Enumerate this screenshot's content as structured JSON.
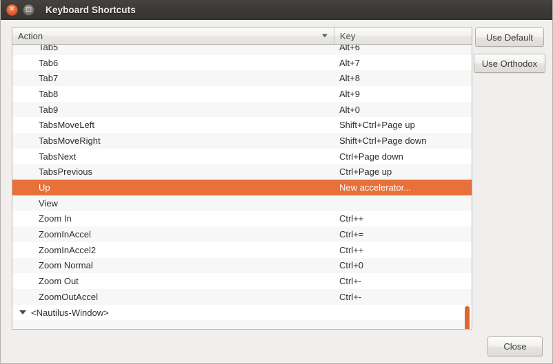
{
  "window": {
    "title": "Keyboard Shortcuts",
    "close_glyph": "✕",
    "maximize_glyph": "□",
    "accent_color": "#e8703a",
    "titlebar_color": "#3a3935"
  },
  "table": {
    "columns": [
      {
        "label": "Action",
        "sort": "descending"
      },
      {
        "label": "Key"
      }
    ],
    "rows": [
      {
        "action": "Tab5",
        "key": "Alt+6",
        "clipped": true
      },
      {
        "action": "Tab6",
        "key": "Alt+7"
      },
      {
        "action": "Tab7",
        "key": "Alt+8"
      },
      {
        "action": "Tab8",
        "key": "Alt+9"
      },
      {
        "action": "Tab9",
        "key": "Alt+0"
      },
      {
        "action": "TabsMoveLeft",
        "key": "Shift+Ctrl+Page up"
      },
      {
        "action": "TabsMoveRight",
        "key": "Shift+Ctrl+Page down"
      },
      {
        "action": "TabsNext",
        "key": "Ctrl+Page down"
      },
      {
        "action": "TabsPrevious",
        "key": "Ctrl+Page up"
      },
      {
        "action": "Up",
        "key": "New accelerator...",
        "selected": true
      },
      {
        "action": "View",
        "key": ""
      },
      {
        "action": "Zoom In",
        "key": "Ctrl++"
      },
      {
        "action": "ZoomInAccel",
        "key": "Ctrl+="
      },
      {
        "action": "ZoomInAccel2",
        "key": "Ctrl++"
      },
      {
        "action": "Zoom Normal",
        "key": "Ctrl+0"
      },
      {
        "action": "Zoom Out",
        "key": "Ctrl+-"
      },
      {
        "action": "ZoomOutAccel",
        "key": "Ctrl+-"
      },
      {
        "action": "<Nautilus-Window>",
        "key": "",
        "group": true,
        "expanded": true
      },
      {
        "action": "",
        "key": "",
        "partial": true
      }
    ]
  },
  "scrollbar": {
    "thumb_top_pct": 92,
    "thumb_height_pct": 14
  },
  "buttons": {
    "use_default": "Use Default",
    "use_orthodox": "Use Orthodox",
    "close": "Close"
  }
}
